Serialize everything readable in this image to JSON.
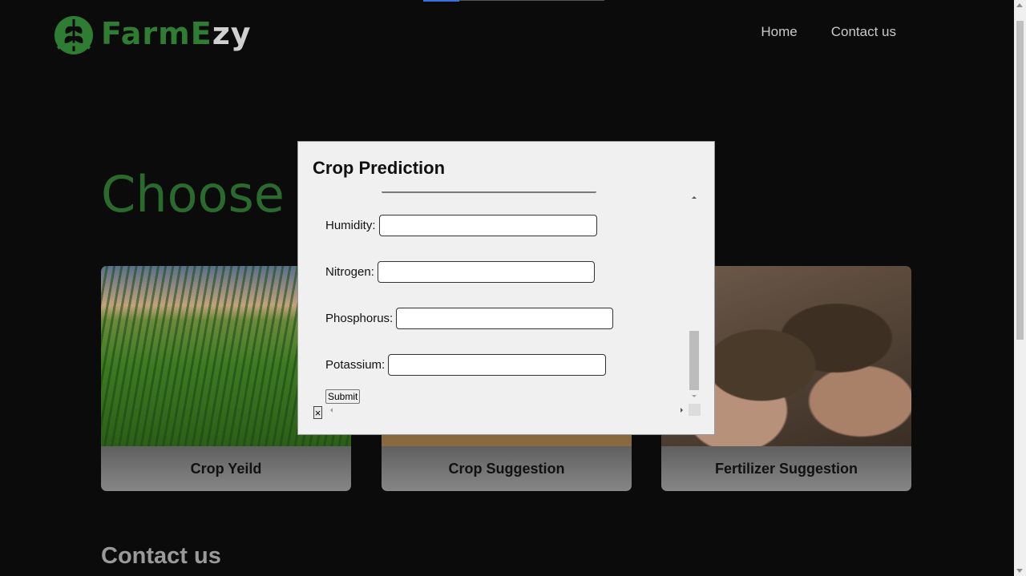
{
  "brand": {
    "name_part1": "Farm",
    "name_part2": "E",
    "name_part3": "zy"
  },
  "nav": {
    "home": "Home",
    "contact": "Contact us"
  },
  "hero": {
    "title_visible": "Choose y"
  },
  "cards": [
    {
      "label": "Crop Yeild"
    },
    {
      "label": "Crop Suggestion"
    },
    {
      "label": "Fertilizer Suggestion"
    }
  ],
  "contact": {
    "title": "Contact us"
  },
  "modal": {
    "title": "Crop Prediction",
    "fields": {
      "humidity": {
        "label": "Humidity:",
        "value": ""
      },
      "nitrogen": {
        "label": "Nitrogen:",
        "value": ""
      },
      "phosphorus": {
        "label": "Phosphorus:",
        "value": ""
      },
      "potassium": {
        "label": "Potassium:",
        "value": ""
      }
    },
    "submit_label": "Submit",
    "close_label": "×"
  },
  "colors": {
    "brand_green": "#2e7d32",
    "page_bg": "#0b0b0b",
    "modal_bg": "#f0f0f0"
  }
}
